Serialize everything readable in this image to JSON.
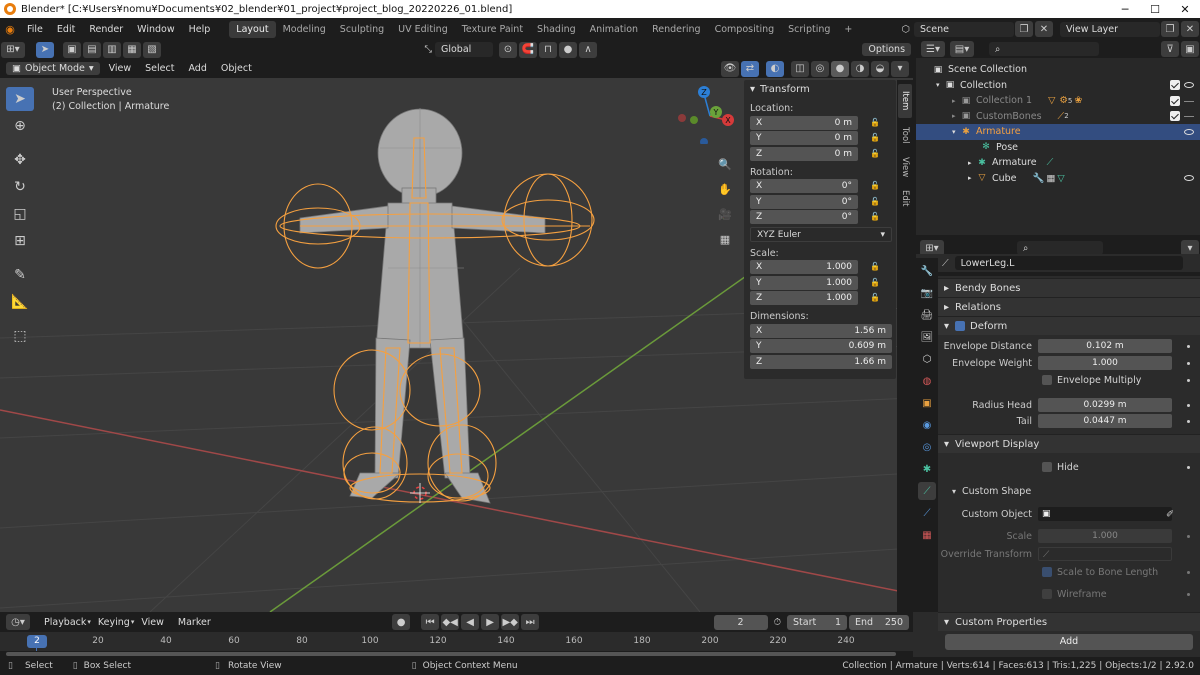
{
  "window": {
    "title": "Blender* [C:¥Users¥nomu¥Documents¥02_blender¥01_project¥project_blog_20220226_01.blend]"
  },
  "menu": [
    "File",
    "Edit",
    "Render",
    "Window",
    "Help"
  ],
  "workspaces": [
    "Layout",
    "Modeling",
    "Sculpting",
    "UV Editing",
    "Texture Paint",
    "Shading",
    "Animation",
    "Rendering",
    "Compositing",
    "Scripting"
  ],
  "scene": "Scene",
  "view_layer": "View Layer",
  "viewport": {
    "transform_orientation": "Global",
    "options": "Options",
    "mode": "Object Mode",
    "menus": [
      "View",
      "Select",
      "Add",
      "Object"
    ],
    "info_line1": "User Perspective",
    "info_line2": "(2) Collection | Armature"
  },
  "npanel": {
    "title": "Transform",
    "location_label": "Location:",
    "location": [
      {
        "axis": "X",
        "value": "0 m"
      },
      {
        "axis": "Y",
        "value": "0 m"
      },
      {
        "axis": "Z",
        "value": "0 m"
      }
    ],
    "rotation_label": "Rotation:",
    "rotation": [
      {
        "axis": "X",
        "value": "0°"
      },
      {
        "axis": "Y",
        "value": "0°"
      },
      {
        "axis": "Z",
        "value": "0°"
      }
    ],
    "rotation_mode": "XYZ Euler",
    "scale_label": "Scale:",
    "scale": [
      {
        "axis": "X",
        "value": "1.000"
      },
      {
        "axis": "Y",
        "value": "1.000"
      },
      {
        "axis": "Z",
        "value": "1.000"
      }
    ],
    "dimensions_label": "Dimensions:",
    "dimensions": [
      {
        "axis": "X",
        "value": "1.56 m"
      },
      {
        "axis": "Y",
        "value": "0.609 m"
      },
      {
        "axis": "Z",
        "value": "1.66 m"
      }
    ],
    "tabs": [
      "Item",
      "Tool",
      "View",
      "Edit"
    ]
  },
  "gizmo": {
    "x": "X",
    "y": "Y",
    "z": "Z"
  },
  "outliner": {
    "root": "Scene Collection",
    "rows": [
      {
        "label": "Collection",
        "level": 1
      },
      {
        "label": "Collection 1",
        "level": 2,
        "badge": "5"
      },
      {
        "label": "CustomBones",
        "level": 2,
        "badge": "2"
      },
      {
        "label": "Armature",
        "level": 2
      },
      {
        "label": "Pose",
        "level": 3
      },
      {
        "label": "Armature",
        "level": 3
      },
      {
        "label": "Cube",
        "level": 3
      }
    ]
  },
  "properties": {
    "bone_name": "LowerLeg.L",
    "sections": {
      "bendy_bones": "Bendy Bones",
      "relations": "Relations",
      "deform": "Deform",
      "viewport_display": "Viewport Display",
      "custom_shape": "Custom Shape",
      "custom_properties": "Custom Properties"
    },
    "envelope_distance_label": "Envelope Distance",
    "envelope_distance": "0.102 m",
    "envelope_weight_label": "Envelope Weight",
    "envelope_weight": "1.000",
    "envelope_multiply": "Envelope Multiply",
    "radius_head_label": "Radius Head",
    "radius_head": "0.0299 m",
    "tail_label": "Tail",
    "tail": "0.0447 m",
    "hide": "Hide",
    "custom_object_label": "Custom Object",
    "scale_label": "Scale",
    "scale": "1.000",
    "override_transform_label": "Override Transform",
    "scale_to_bone_length": "Scale to Bone Length",
    "wireframe": "Wireframe",
    "add": "Add"
  },
  "timeline": {
    "menus": [
      "Playback",
      "Keying",
      "View",
      "Marker"
    ],
    "current_frame": "2",
    "start_label": "Start",
    "start": "1",
    "end_label": "End",
    "end": "250",
    "ticks": [
      "20",
      "40",
      "60",
      "80",
      "100",
      "120",
      "140",
      "160",
      "180",
      "200",
      "220",
      "240"
    ]
  },
  "status": {
    "select": "Select",
    "box_select": "Box Select",
    "rotate_view": "Rotate View",
    "context_menu": "Object Context Menu",
    "stats": "Collection | Armature | Verts:614 | Faces:613 | Tris:1,225 | Objects:1/2 | 2.92.0"
  },
  "colors": {
    "accent": "#4772b3",
    "armature": "#f5a040",
    "selected_row": "#334d80",
    "viewport_bg": "#393939"
  }
}
